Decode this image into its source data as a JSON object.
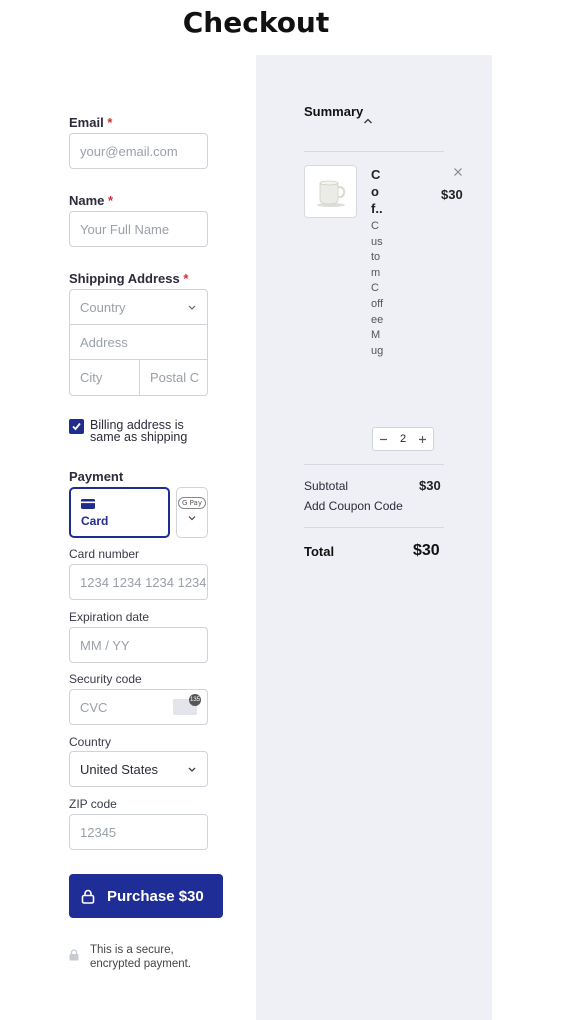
{
  "page": {
    "title": "Checkout"
  },
  "form": {
    "email": {
      "label": "Email",
      "required": "*",
      "placeholder": "your@email.com"
    },
    "name": {
      "label": "Name",
      "required": "*",
      "placeholder": "Your Full Name"
    },
    "shipping": {
      "label": "Shipping Address",
      "required": "*",
      "country_placeholder": "Country",
      "address_placeholder": "Address",
      "city_placeholder": "City",
      "postal_placeholder": "Postal C"
    },
    "billing_same": {
      "label": "Billing address is same as shipping",
      "checked": true
    },
    "payment": {
      "label": "Payment",
      "method_selected": "Card",
      "other_method_badge": "G Pay",
      "card_number": {
        "label": "Card number",
        "placeholder": "1234 1234 1234 1234"
      },
      "expiration": {
        "label": "Expiration date",
        "placeholder": "MM / YY"
      },
      "security": {
        "label": "Security code",
        "placeholder": "CVC",
        "icon_badge": "135"
      },
      "country": {
        "label": "Country",
        "value": "United States"
      },
      "zip": {
        "label": "ZIP code",
        "placeholder": "12345"
      }
    },
    "purchase_label": "Purchase $30",
    "secure_note": "This is a secure, encrypted payment."
  },
  "summary": {
    "title": "Summary",
    "item": {
      "name": "Cof..",
      "description": "Custom Coffee Mug",
      "price": "$30",
      "quantity": "2",
      "image": "coffee-mug-icon"
    },
    "subtotal_label": "Subtotal",
    "subtotal_value": "$30",
    "coupon_label": "Add Coupon Code",
    "total_label": "Total",
    "total_value": "$30"
  },
  "colors": {
    "accent": "#1f2d96",
    "panel": "#eef0f5",
    "required": "#d32f2f"
  }
}
